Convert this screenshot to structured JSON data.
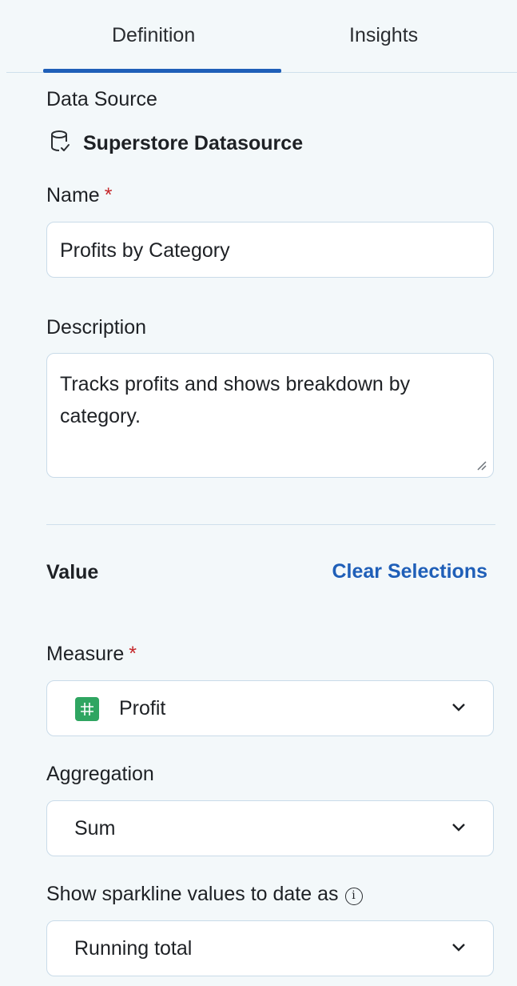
{
  "tabs": [
    {
      "label": "Definition",
      "active": true
    },
    {
      "label": "Insights",
      "active": false
    }
  ],
  "data_source": {
    "label": "Data Source",
    "name": "Superstore Datasource",
    "icon": "database-check-icon"
  },
  "name_field": {
    "label": "Name",
    "required_mark": "*",
    "value": "Profits by Category"
  },
  "description_field": {
    "label": "Description",
    "value": "Tracks profits and shows breakdown by category."
  },
  "value_section": {
    "heading": "Value",
    "clear_label": "Clear Selections"
  },
  "measure": {
    "label": "Measure",
    "required_mark": "*",
    "value": "Profit",
    "icon": "number-grid-icon",
    "icon_color": "#2fa561"
  },
  "aggregation": {
    "label": "Aggregation",
    "value": "Sum"
  },
  "sparkline": {
    "label": "Show sparkline values to date as",
    "info_glyph": "i",
    "value": "Running total"
  },
  "colors": {
    "accent": "#1f5fb8",
    "background": "#f3f8fa",
    "required": "#c5272a"
  }
}
